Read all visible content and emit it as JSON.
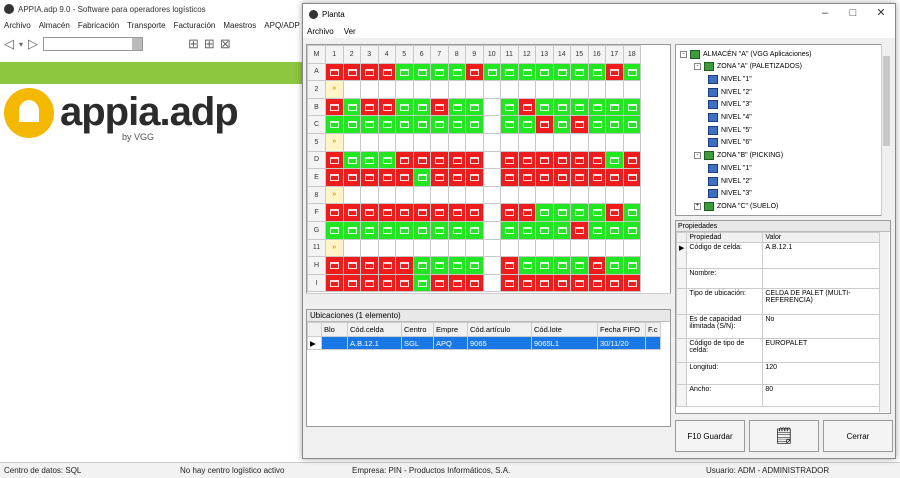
{
  "bg": {
    "title": "APPIA.adp 9.0 - Software para operadores logísticos",
    "menu": [
      "Archivo",
      "Almacén",
      "Fabricación",
      "Transporte",
      "Facturación",
      "Maestros",
      "APQ/ADP"
    ],
    "logo_word": "appia.adp",
    "logo_sub": "by VGG",
    "brand_green": "#8dc63f",
    "brand_yellow": "#f5b800"
  },
  "status": {
    "db": "Centro de datos: SQL",
    "centro": "No hay centro logístico activo",
    "empresa": "Empresa: PIN - Productos Informáticos, S.A.",
    "usuario": "Usuario: ADM - ADMINISTRADOR"
  },
  "window": {
    "title": "Planta",
    "menu": [
      "Archivo",
      "Ver"
    ]
  },
  "grid": {
    "corner": "M",
    "columns": [
      "1",
      "2",
      "3",
      "4",
      "5",
      "6",
      "7",
      "8",
      "9",
      "10",
      "11",
      "12",
      "13",
      "14",
      "15",
      "16",
      "17",
      "18"
    ],
    "rows": [
      {
        "label": "A",
        "cells": "RRRRGGGGRGGGGGGGRG"
      },
      {
        "label": "2",
        "cells": ">................."
      },
      {
        "label": "B",
        "cells": "RGRRGGRGG.GRGGGGGG"
      },
      {
        "label": "C",
        "cells": "GGGGGGGGG.GGRGRGGG"
      },
      {
        "label": "5",
        "cells": ">................."
      },
      {
        "label": "D",
        "cells": "RGGGRRRRR.RRRRRRGR"
      },
      {
        "label": "E",
        "cells": "RRRRRGRRR.RRRRRRRR"
      },
      {
        "label": "8",
        "cells": ">................."
      },
      {
        "label": "F",
        "cells": "RRRRRRRRR.RRGGGGRG"
      },
      {
        "label": "G",
        "cells": "GGGGGGGGG.GGGGRGGG"
      },
      {
        "label": "11",
        "cells": ">................."
      },
      {
        "label": "H",
        "cells": "RRRRRGGGG.RGGGGRGG"
      },
      {
        "label": "I",
        "cells": "RRRRRGRRR.RRRRRRRR"
      }
    ]
  },
  "tree": [
    {
      "label": "ALMACÉN \"A\" (VGG Aplicaciones)",
      "level": 0,
      "kind": "zone",
      "pm": "-"
    },
    {
      "label": "ZONA \"A\" (PALETIZADOS)",
      "level": 1,
      "kind": "zone",
      "pm": "-"
    },
    {
      "label": "NIVEL \"1\"",
      "level": 2,
      "kind": "level"
    },
    {
      "label": "NIVEL \"2\"",
      "level": 2,
      "kind": "level"
    },
    {
      "label": "NIVEL \"3\"",
      "level": 2,
      "kind": "level"
    },
    {
      "label": "NIVEL \"4\"",
      "level": 2,
      "kind": "level"
    },
    {
      "label": "NIVEL \"5\"",
      "level": 2,
      "kind": "level"
    },
    {
      "label": "NIVEL \"6\"",
      "level": 2,
      "kind": "level"
    },
    {
      "label": "ZONA \"B\" (PICKING)",
      "level": 1,
      "kind": "zone",
      "pm": "-"
    },
    {
      "label": "NIVEL \"1\"",
      "level": 2,
      "kind": "level"
    },
    {
      "label": "NIVEL \"2\"",
      "level": 2,
      "kind": "level"
    },
    {
      "label": "NIVEL \"3\"",
      "level": 2,
      "kind": "level"
    },
    {
      "label": "ZONA \"C\" (SUELO)",
      "level": 1,
      "kind": "zone",
      "pm": "+"
    }
  ],
  "props": {
    "header": "Propiedades",
    "col_prop": "Propiedad",
    "col_val": "Valor",
    "rows": [
      {
        "k": "Código de celda:",
        "v": "A.B.12.1"
      },
      {
        "k": "Nombre:",
        "v": ""
      },
      {
        "k": "Tipo de ubicación:",
        "v": "CELDA DE PALET (MULTI-REFERENCIA)"
      },
      {
        "k": "Es de capacidad ilimitada (S/N):",
        "v": "No"
      },
      {
        "k": "Código de tipo de celda:",
        "v": "EUROPALET"
      },
      {
        "k": "Longitud:",
        "v": "120"
      },
      {
        "k": "Ancho:",
        "v": "80"
      }
    ]
  },
  "ubic": {
    "header": "Ubicaciones (1 elemento)",
    "columns": [
      "Blo",
      "Cód.celda",
      "Centro",
      "Empre",
      "Cód.artículo",
      "Cód.lote",
      "Fecha FIFO",
      "F.c"
    ],
    "row": [
      "",
      "A.B.12.1",
      "SGL",
      "APQ",
      "9065",
      "9065L1",
      "30/11/20",
      ""
    ]
  },
  "buttons": {
    "guardar": "F10 Guardar",
    "cerrar": "Cerrar"
  }
}
